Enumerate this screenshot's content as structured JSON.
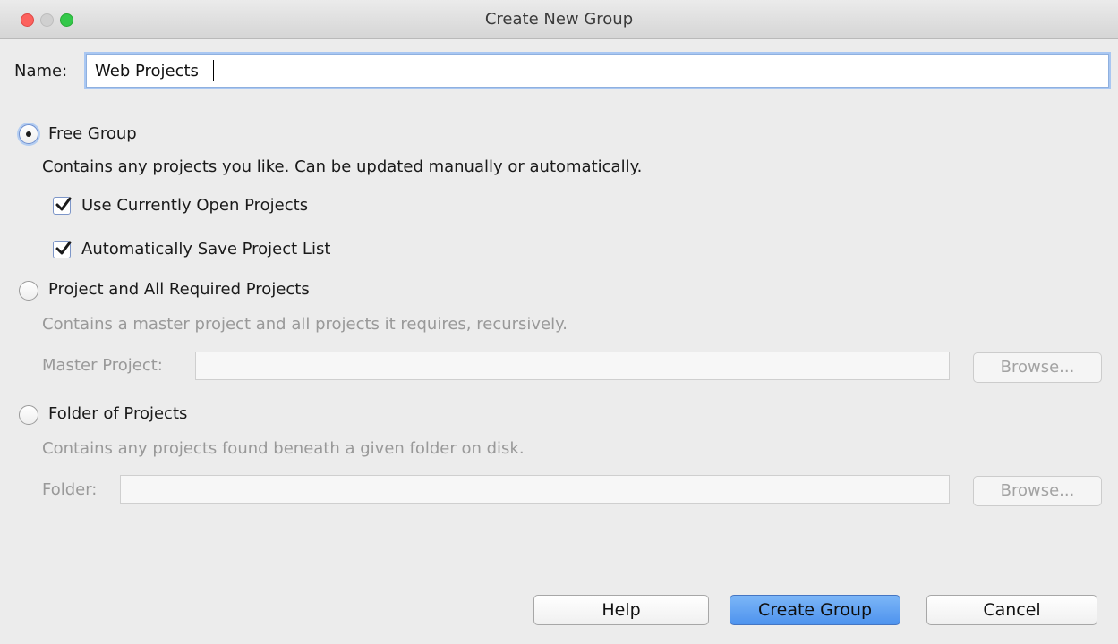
{
  "window": {
    "title": "Create New Group"
  },
  "name_field": {
    "label": "Name:",
    "value": "Web Projects"
  },
  "options": {
    "free_group": {
      "label": "Free Group",
      "description": "Contains any projects you like. Can be updated manually or automatically.",
      "selected": true,
      "use_open_projects_label": "Use Currently Open Projects",
      "use_open_projects_checked": true,
      "auto_save_label": "Automatically Save Project List",
      "auto_save_checked": true
    },
    "required_projects": {
      "label": "Project and All Required Projects",
      "description": "Contains a master project and all projects it requires, recursively.",
      "selected": false,
      "master_label": "Master Project:",
      "master_value": "",
      "browse_label": "Browse..."
    },
    "folder": {
      "label": "Folder of Projects",
      "description": "Contains any projects found beneath a given folder on disk.",
      "selected": false,
      "folder_label": "Folder:",
      "folder_value": "",
      "browse_label": "Browse..."
    }
  },
  "buttons": {
    "help": "Help",
    "create": "Create Group",
    "cancel": "Cancel"
  },
  "colors": {
    "primary_button": "#4e93ee",
    "focus_ring": "#a9c7f2",
    "close": "#fc615d",
    "zoom": "#34c84a"
  }
}
